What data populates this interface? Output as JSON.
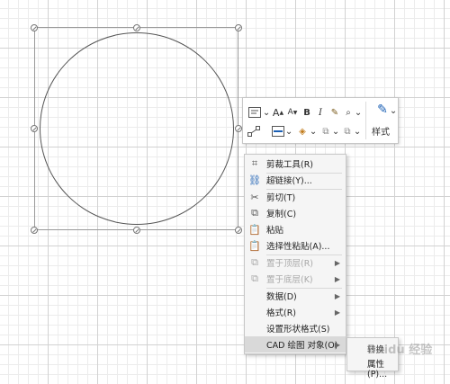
{
  "toolbar": {
    "row1": [
      "A",
      "A",
      "B",
      "I"
    ],
    "style_label": "样式"
  },
  "context_menu": {
    "items": [
      {
        "label": "剪裁工具(R)",
        "icon": "crop-icon",
        "disabled": false,
        "submenu": false
      },
      {
        "label": "超链接(Y)...",
        "icon": "hyperlink-icon",
        "disabled": false,
        "submenu": false
      },
      {
        "label": "剪切(T)",
        "icon": "scissors-icon",
        "disabled": false,
        "submenu": false
      },
      {
        "label": "复制(C)",
        "icon": "copy-icon",
        "disabled": false,
        "submenu": false
      },
      {
        "label": "粘贴",
        "icon": "paste-icon",
        "disabled": false,
        "submenu": false
      },
      {
        "label": "选择性粘贴(A)...",
        "icon": "paste-special-icon",
        "disabled": false,
        "submenu": false
      },
      {
        "label": "置于顶层(R)",
        "icon": "bring-to-front-icon",
        "disabled": true,
        "submenu": true
      },
      {
        "label": "置于底层(K)",
        "icon": "send-to-back-icon",
        "disabled": true,
        "submenu": true
      },
      {
        "label": "数据(D)",
        "icon": "",
        "disabled": false,
        "submenu": true
      },
      {
        "label": "格式(R)",
        "icon": "",
        "disabled": false,
        "submenu": true
      },
      {
        "label": "设置形状格式(S)",
        "icon": "",
        "disabled": false,
        "submenu": false
      },
      {
        "label": "CAD 绘图 对象(O)",
        "icon": "",
        "disabled": false,
        "submenu": true,
        "highlighted": true
      }
    ]
  },
  "submenu": {
    "items": [
      "转换",
      "属性(P)..."
    ]
  },
  "watermark": "Baidu 经验"
}
